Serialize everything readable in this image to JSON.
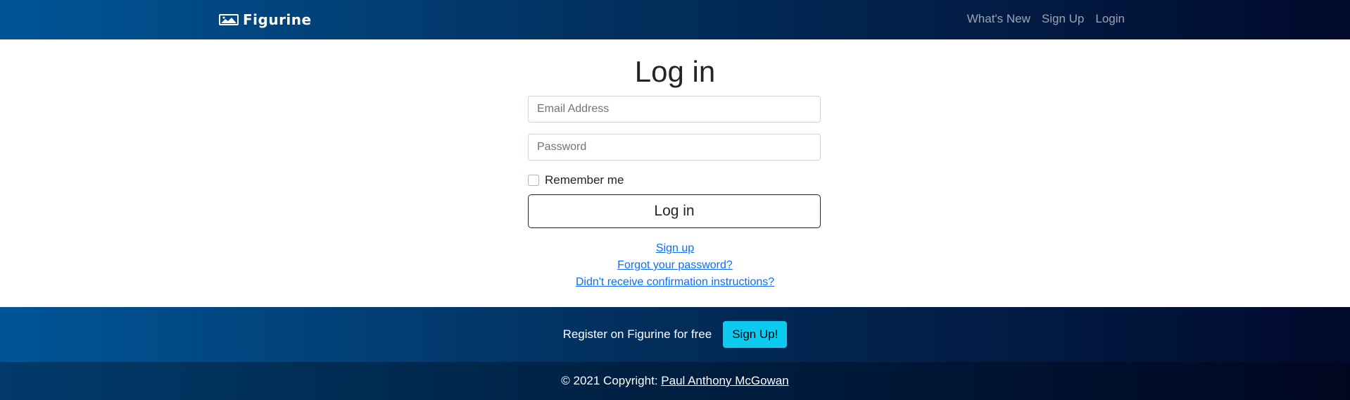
{
  "navbar": {
    "brand": "Figurine",
    "links": [
      "What's New",
      "Sign Up",
      "Login"
    ]
  },
  "login": {
    "title": "Log in",
    "email_placeholder": "Email Address",
    "password_placeholder": "Password",
    "remember_label": "Remember me",
    "remember_checked": false,
    "submit_label": "Log in",
    "links": [
      "Sign up",
      "Forgot your password?",
      "Didn't receive confirmation instructions?"
    ]
  },
  "cta": {
    "text": "Register on Figurine for free",
    "button_label": "Sign Up!"
  },
  "footer": {
    "copyright_prefix": "© 2021 Copyright:",
    "author": "Paul Anthony McGowan"
  },
  "colors": {
    "navbar_gradient_start": "#015597",
    "navbar_gradient_end": "#010a2c",
    "link": "#0d6efd",
    "cta_button": "#0dcaf0"
  },
  "icons": {
    "brand": "landscape-image-icon"
  }
}
